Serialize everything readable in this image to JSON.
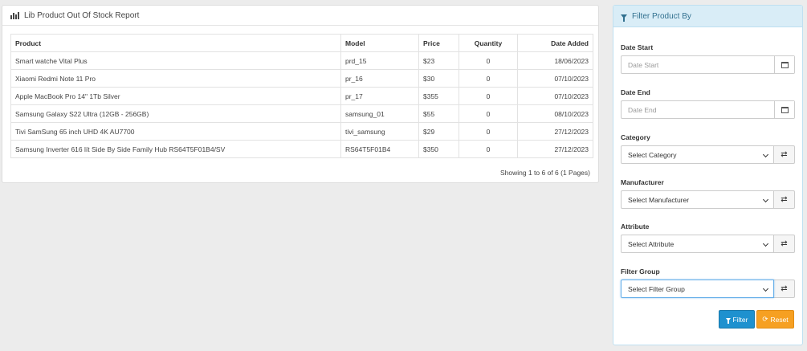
{
  "report": {
    "title": "Lib Product Out Of Stock Report",
    "columns": [
      "Product",
      "Model",
      "Price",
      "Quantity",
      "Date Added"
    ],
    "rows": [
      [
        "Smart watche Vital Plus",
        "prd_15",
        "$23",
        "0",
        "18/06/2023"
      ],
      [
        "Xiaomi Redmi Note 11 Pro",
        "pr_16",
        "$30",
        "0",
        "07/10/2023"
      ],
      [
        "Apple MacBook Pro 14\" 1Tb Silver",
        "pr_17",
        "$355",
        "0",
        "07/10/2023"
      ],
      [
        "Samsung Galaxy S22 Ultra (12GB - 256GB)",
        "samsung_01",
        "$55",
        "0",
        "08/10/2023"
      ],
      [
        "Tivi SamSung 65 inch UHD 4K AU7700",
        "tivi_samsung",
        "$29",
        "0",
        "27/12/2023"
      ],
      [
        "Samsung Inverter 616 lít Side By Side Family Hub RS64T5F01B4/SV",
        "RS64T5F01B4",
        "$350",
        "0",
        "27/12/2023"
      ]
    ],
    "pagination": "Showing 1 to 6 of 6 (1 Pages)"
  },
  "filter": {
    "title": "Filter Product By",
    "date_start": {
      "label": "Date Start",
      "placeholder": "Date Start"
    },
    "date_end": {
      "label": "Date End",
      "placeholder": "Date End"
    },
    "category": {
      "label": "Category",
      "value": "Select Category"
    },
    "manufacturer": {
      "label": "Manufacturer",
      "value": "Select Manufacturer"
    },
    "attribute": {
      "label": "Attribute",
      "value": "Select Attribute"
    },
    "filter_group": {
      "label": "Filter Group",
      "value": "Select Filter Group"
    },
    "filter_button": "Filter",
    "reset_button": "Reset"
  },
  "colors": {
    "accent_blue": "#1e91cf",
    "reset_orange": "#f6a022",
    "panel_header_blue": "#d9edf7"
  }
}
